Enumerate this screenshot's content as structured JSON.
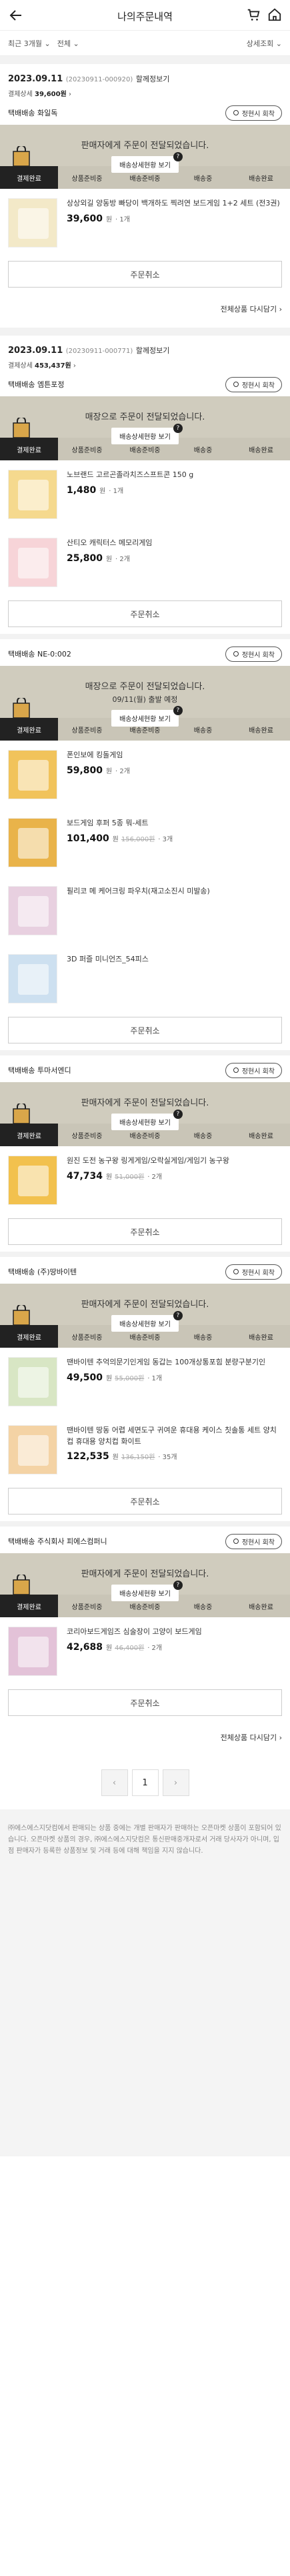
{
  "header": {
    "title": "나의주문내역"
  },
  "filter": {
    "period": "최근 3개월",
    "status": "전체",
    "detail": "상세조회"
  },
  "orders": [
    {
      "date": "2023.09.11",
      "no": "(20230911-000920)",
      "link": "할께정보기",
      "pay_label": "결제상세",
      "pay_amount": "39,600원",
      "sellers": [
        {
          "name": "택배배송 화일독",
          "step": "판매자에게 주문이 전달되었습니다.",
          "sub": "",
          "status_btn": "배송상세현황 보기",
          "items": [
            {
              "name": "상상외길 양동방 빠당이 백개하도 찍려연 보드게임 1+2 세트 (전3권)",
              "price": "39,600",
              "unit": "원",
              "qty": "· 1개",
              "orig": ""
            }
          ]
        }
      ],
      "rebuy": "전체상품 다시담기"
    },
    {
      "date": "2023.09.11",
      "no": "(20230911-000771)",
      "link": "할께정보기",
      "pay_label": "결제상세",
      "pay_amount": "453,437원",
      "sellers": [
        {
          "name": "택배배송 엠튼포정",
          "step": "매장으로 주문이 전달되었습니다.",
          "sub": "",
          "status_btn": "배송상세현황 보기",
          "items": [
            {
              "name": "노브랜드 고르곤졸라치즈스프트콘 150 g",
              "price": "1,480",
              "unit": "원",
              "qty": "· 1개",
              "orig": ""
            },
            {
              "name": "산티오 캐릭터스 메모리게임",
              "price": "25,800",
              "unit": "원",
              "qty": "· 2개",
              "orig": ""
            }
          ]
        },
        {
          "name": "택배배송 NE-0:002",
          "step": "매장으로 주문이 전달되었습니다.",
          "sub": "09/11(월) 출발 예정",
          "status_btn": "배송상세현황 보기",
          "items": [
            {
              "name": "폰인보에 킹돌게임",
              "price": "59,800",
              "unit": "원",
              "qty": "· 2개",
              "orig": ""
            },
            {
              "name": "보드게임 후퍼 5종 뭐-세트",
              "price": "101,400",
              "unit": "원",
              "qty": "· 3개",
              "orig": "156,000원"
            },
            {
              "name": "필리코 메 케어크링 파우치(재고소진시 미발송)",
              "price": "",
              "unit": "",
              "qty": "",
              "orig": ""
            },
            {
              "name": "3D 퍼즐 미니언즈_54피스",
              "price": "",
              "unit": "",
              "qty": "",
              "orig": ""
            }
          ]
        },
        {
          "name": "택배배송 투마서엔디",
          "step": "판매자에게 주문이 전달되었습니다.",
          "sub": "",
          "status_btn": "배송상세현황 보기",
          "items": [
            {
              "name": "원진 도전 농구왕 링게게임/오락실게임/게임기 농구왕",
              "price": "47,734",
              "unit": "원",
              "qty": "· 2개",
              "orig": "51,000원"
            }
          ]
        },
        {
          "name": "택배배송 (주)땅바이텐",
          "step": "판매자에게 주문이 전달되었습니다.",
          "sub": "",
          "status_btn": "배송상세현황 보기",
          "items": [
            {
              "name": "땐바이텐 추억의문기인게임 동갑는 100개상통포힘 분량구분기인",
              "price": "49,500",
              "unit": "원",
              "qty": "· 1개",
              "orig": "55,000원"
            },
            {
              "name": "땐바이텐 땅동 어렵 세면도구 귀여운 휴대용 케이스 칫솔통 세트 양치컵 휴대용 양치컵 화이트",
              "price": "122,535",
              "unit": "원",
              "qty": "· 35개",
              "orig": "136,150원"
            }
          ]
        },
        {
          "name": "택배배송 주식회사 피에스컴퍼니",
          "step": "판매자에게 주문이 전달되었습니다.",
          "sub": "",
          "status_btn": "배송상세현황 보기",
          "items": [
            {
              "name": "코리아보드게임즈 심술장이 고양이 보드게임",
              "price": "42,688",
              "unit": "원",
              "qty": "· 2개",
              "orig": "46,400원"
            }
          ]
        }
      ],
      "rebuy": "전체상품 다시담기"
    }
  ],
  "reorder_label": "정현시 회착",
  "cancel_label": "주문취소",
  "steps": [
    "결제완료",
    "상품준비중",
    "배송준비중",
    "배송중",
    "배송완료"
  ],
  "pager": {
    "current": "1"
  },
  "footer": "㈜에스에스지닷컴에서 판매되는 상품 중에는 개별 판매자가 판매하는 오픈마켓 상품이 포함되어 있습니다. 오픈마켓 상품의 경우, ㈜에스에스지닷컴은 통신판매중개자로서 거래 당사자가 아니며, 입점 판매자가 등록한 상품정보 및 거래 등에 대해 책임을 지지 않습니다."
}
